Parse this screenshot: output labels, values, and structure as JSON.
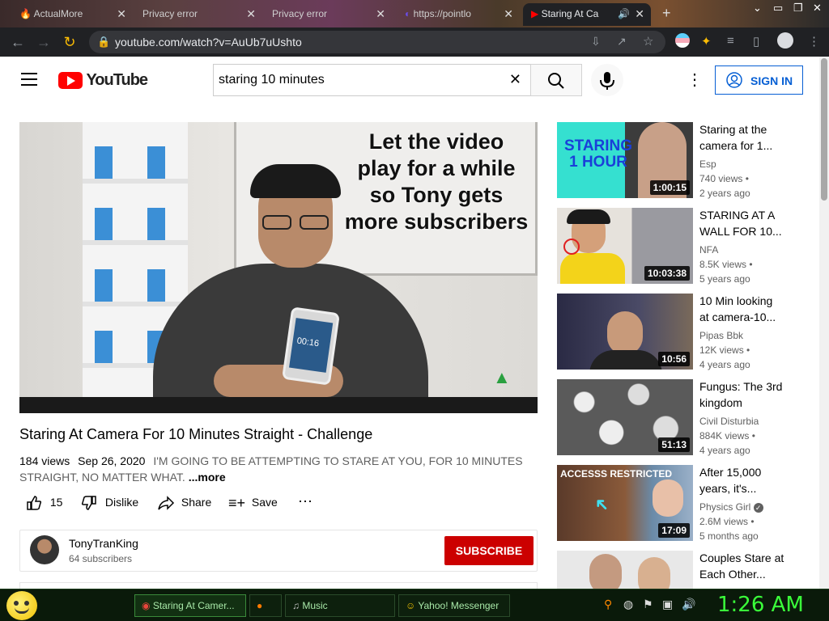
{
  "browser": {
    "tabs": [
      {
        "label": "ActualMore"
      },
      {
        "label": "Privacy error"
      },
      {
        "label": "Privacy error"
      },
      {
        "label": "https://pointlo"
      },
      {
        "label": "Staring At Ca"
      }
    ],
    "url": "youtube.com/watch?v=AuUb7uUshto"
  },
  "youtube": {
    "logo_text": "YouTube",
    "search_value": "staring 10 minutes",
    "signin_label": "SIGN IN"
  },
  "video": {
    "overlay_text": [
      "Let the video",
      "play for a while",
      "so Tony gets",
      "more subscribers"
    ],
    "phone_text": "00:16",
    "title": "Staring At Camera For 10 Minutes Straight - Challenge",
    "views": "184 views",
    "date": "Sep 26, 2020",
    "description": "I'M GOING TO BE ATTEMPTING TO STARE AT YOU, FOR 10 MINUTES STRAIGHT, NO MATTER WHAT.",
    "more_label": "...more",
    "likes": "15",
    "dislike_label": "Dislike",
    "share_label": "Share",
    "save_label": "Save",
    "channel_name": "TonyTranKing",
    "subscribers": "64 subscribers",
    "subscribe_label": "SUBSCRIBE"
  },
  "related": [
    {
      "title": "Staring at the camera for 1...",
      "channel": "Esp",
      "views": "740 views",
      "age": "2 years ago",
      "duration": "1:00:15",
      "thumb_text": "STARING 1 HOUR"
    },
    {
      "title": "STARING AT A WALL FOR 10...",
      "channel": "NFA",
      "views": "8.5K views",
      "age": "5 years ago",
      "duration": "10:03:38"
    },
    {
      "title": "10 Min looking at camera-10...",
      "channel": "Pipas Bbk",
      "views": "12K views",
      "age": "4 years ago",
      "duration": "10:56"
    },
    {
      "title": "Fungus: The 3rd kingdom",
      "channel": "Civil Disturbia",
      "views": "884K views",
      "age": "4 years ago",
      "duration": "51:13"
    },
    {
      "title": "After 15,000 years, it's...",
      "channel": "Physics Girl",
      "views": "2.6M views",
      "age": "5 months ago",
      "duration": "17:09",
      "thumb_text": "ACCESSS RESTRICTED"
    },
    {
      "title": "Couples Stare at Each Other...",
      "channel": "",
      "views": "",
      "age": "",
      "duration": ""
    }
  ],
  "taskbar": {
    "tasks": [
      {
        "label": "Staring At Camer..."
      },
      {
        "label": ""
      },
      {
        "label": "Music"
      },
      {
        "label": "Yahoo! Messenger"
      }
    ],
    "clock": "1:26 AM"
  }
}
